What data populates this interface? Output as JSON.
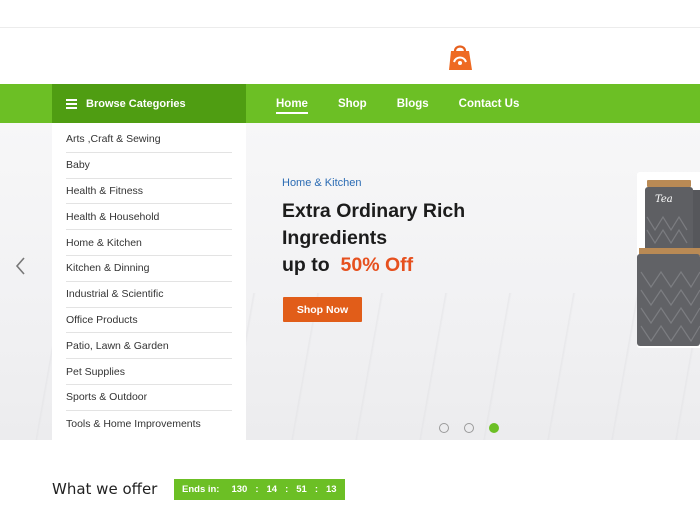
{
  "nav": {
    "browse_label": "Browse Categories",
    "links": [
      "Home",
      "Shop",
      "Blogs",
      "Contact Us"
    ]
  },
  "categories": [
    "Arts ,Craft & Sewing",
    "Baby",
    "Health & Fitness",
    "Health & Household",
    "Home & Kitchen",
    "Kitchen & Dinning",
    "Industrial & Scientific",
    "Office Products",
    "Patio, Lawn & Garden",
    "Pet Supplies",
    "Sports & Outdoor",
    "Tools & Home Improvements"
  ],
  "hero": {
    "subtitle": "Home & Kitchen",
    "title_line1": "Extra Ordinary Rich",
    "title_line2": "Ingredients",
    "title_line3_prefix": "up to",
    "title_line3_accent": "50% Off",
    "button_label": "Shop Now",
    "product_label": "Tea"
  },
  "slider": {
    "count": 3,
    "active_index": 2
  },
  "offer": {
    "title": "What we offer",
    "ends_label": "Ends in:",
    "days": "130",
    "hours": "14",
    "minutes": "51",
    "seconds": "13"
  },
  "colors": {
    "brand_green": "#6cbf25",
    "dark_green": "#4f9d12",
    "accent_orange": "#e15d19",
    "link_blue": "#2a6bb3"
  }
}
